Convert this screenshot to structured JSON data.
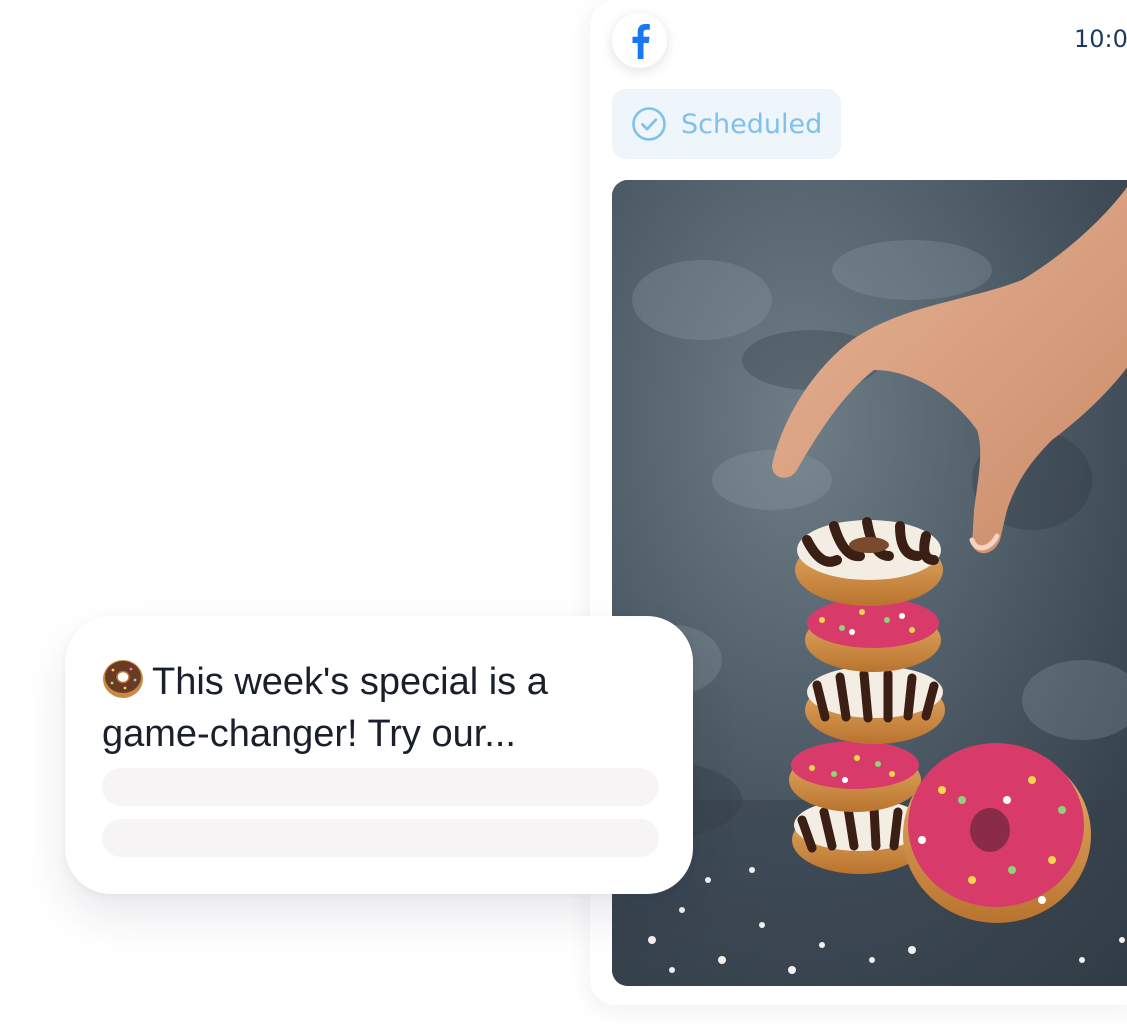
{
  "post": {
    "platform_icon": "facebook-icon",
    "time": "10:0",
    "status": {
      "icon": "check-circle-icon",
      "label": "Scheduled"
    },
    "image": "donut-stack-photo"
  },
  "caption": {
    "emoji": "🍩",
    "line1": "This week's special is a",
    "line2": "game-changer! Try our..."
  },
  "colors": {
    "facebook_blue": "#1877f2",
    "status_text": "#7fc1ea",
    "status_bg": "#eef5fb",
    "caption_text": "#1a1f2e",
    "skeleton": "#f6f4f5"
  }
}
